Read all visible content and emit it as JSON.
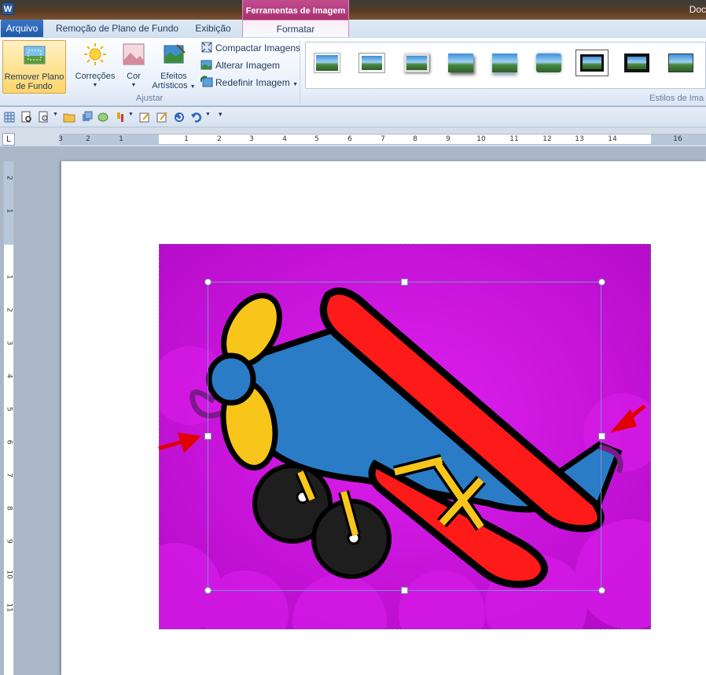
{
  "window": {
    "app_icon_letter": "W",
    "doc_title": "Doc",
    "context_header": "Ferramentas de Imagem"
  },
  "tabs": {
    "file": "Arquivo",
    "remove_bg": "Remoção de Plano de Fundo",
    "view": "Exibição",
    "format": "Formatar"
  },
  "ribbon": {
    "remove_bg_label_1": "Remover Plano",
    "remove_bg_label_2": "de Fundo",
    "corrections": "Correções",
    "color": "Cor",
    "artistic_1": "Efeitos",
    "artistic_2": "Artísticos",
    "compress": "Compactar Imagens",
    "change": "Alterar Imagem",
    "reset": "Redefinir Imagem",
    "group_adjust": "Ajustar",
    "group_styles": "Estilos de Ima"
  },
  "ruler": {
    "h_numbers": [
      "3",
      "2",
      "1",
      "1",
      "2",
      "3",
      "4",
      "5",
      "6",
      "7",
      "8",
      "9",
      "10",
      "11",
      "12",
      "13",
      "14",
      "16"
    ],
    "v_numbers": [
      "2",
      "1",
      "1",
      "2",
      "3",
      "4",
      "5",
      "6",
      "7",
      "8",
      "9",
      "10",
      "11"
    ],
    "corner": "L"
  },
  "colors": {
    "accent_context": "#b63b80",
    "file_tab": "#2a65b3",
    "image_bg": "#c50fd8"
  }
}
